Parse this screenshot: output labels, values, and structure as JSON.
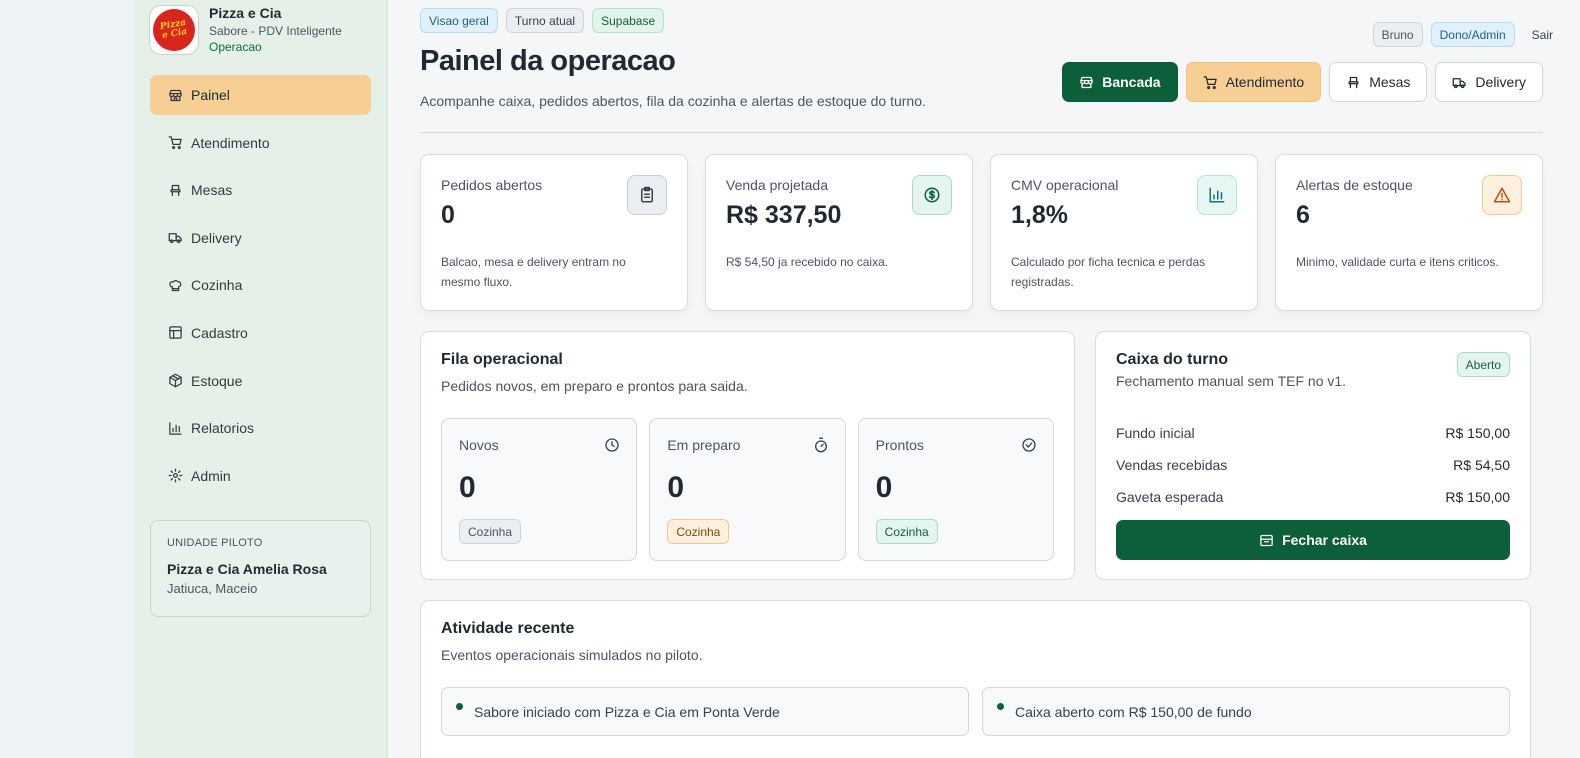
{
  "brand": {
    "name": "Pizza e Cia",
    "subtitle": "Sabore - PDV Inteligente",
    "section": "Operacao",
    "logo_text": "Pizza e Cia"
  },
  "nav": [
    {
      "label": "Painel",
      "icon": "store-icon",
      "active": true
    },
    {
      "label": "Atendimento",
      "icon": "cart-icon"
    },
    {
      "label": "Mesas",
      "icon": "chair-icon"
    },
    {
      "label": "Delivery",
      "icon": "truck-icon"
    },
    {
      "label": "Cozinha",
      "icon": "chef-hat-icon"
    },
    {
      "label": "Cadastro",
      "icon": "table-icon"
    },
    {
      "label": "Estoque",
      "icon": "package-icon"
    },
    {
      "label": "Relatorios",
      "icon": "bar-chart-icon"
    },
    {
      "label": "Admin",
      "icon": "gear-icon"
    }
  ],
  "unit": {
    "caption": "UNIDADE PILOTO",
    "name": "Pizza e Cia Amelia Rosa",
    "location": "Jatiuca, Maceio"
  },
  "header": {
    "tags": [
      "Visao geral",
      "Turno atual",
      "Supabase"
    ],
    "user": "Bruno",
    "role": "Dono/Admin",
    "logout": "Sair",
    "title": "Painel da operacao",
    "subtitle": "Acompanhe caixa, pedidos abertos, fila da cozinha e alertas de estoque do turno.",
    "actions": [
      "Bancada",
      "Atendimento",
      "Mesas",
      "Delivery"
    ]
  },
  "stats": [
    {
      "label": "Pedidos abertos",
      "value": "0",
      "desc": "Balcao, mesa e delivery entram no mesmo fluxo.",
      "icon": "clipboard-icon"
    },
    {
      "label": "Venda projetada",
      "value": "R$ 337,50",
      "desc": "R$ 54,50 ja recebido no caixa.",
      "icon": "dollar-icon"
    },
    {
      "label": "CMV operacional",
      "value": "1,8%",
      "desc": "Calculado por ficha tecnica e perdas registradas.",
      "icon": "bar-chart-icon"
    },
    {
      "label": "Alertas de estoque",
      "value": "6",
      "desc": "Minimo, validade curta e itens criticos.",
      "icon": "warning-icon"
    }
  ],
  "fila": {
    "title": "Fila operacional",
    "subtitle": "Pedidos novos, em preparo e prontos para saida.",
    "cards": [
      {
        "label": "Novos",
        "value": "0",
        "badge": "Cozinha",
        "icon": "clock-icon"
      },
      {
        "label": "Em preparo",
        "value": "0",
        "badge": "Cozinha",
        "icon": "timer-icon"
      },
      {
        "label": "Prontos",
        "value": "0",
        "badge": "Cozinha",
        "icon": "check-circle-icon"
      }
    ]
  },
  "caixa": {
    "title": "Caixa do turno",
    "subtitle": "Fechamento manual sem TEF no v1.",
    "status": "Aberto",
    "rows": [
      {
        "label": "Fundo inicial",
        "value": "R$ 150,00"
      },
      {
        "label": "Vendas recebidas",
        "value": "R$ 54,50"
      },
      {
        "label": "Gaveta esperada",
        "value": "R$ 150,00"
      }
    ],
    "close_label": "Fechar caixa"
  },
  "atividade": {
    "title": "Atividade recente",
    "subtitle": "Eventos operacionais simulados no piloto.",
    "events": [
      "Sabore iniciado com Pizza e Cia em Ponta Verde",
      "Caixa aberto com R$ 150,00 de fundo"
    ]
  }
}
